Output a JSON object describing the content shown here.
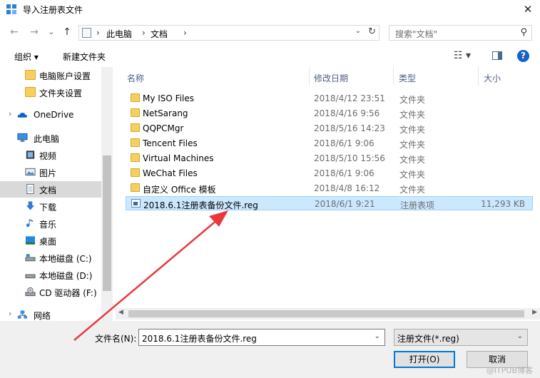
{
  "window": {
    "title": "导入注册表文件",
    "close_glyph": "✕"
  },
  "address": {
    "back_glyph": "←",
    "forward_glyph": "→",
    "recent_glyph": "⌄",
    "up_glyph": "↑",
    "separator": "›",
    "crumbs": [
      "此电脑",
      "文档"
    ],
    "search_placeholder": "搜索\"文档\"",
    "search_glyph": "⚲"
  },
  "toolbar": {
    "organize": "组织 ▾",
    "new_folder": "新建文件夹",
    "view_glyph": "☷ ▾",
    "help_glyph": "?"
  },
  "nav": {
    "items": [
      {
        "label": "电脑账户设置",
        "icon": "folder-icon"
      },
      {
        "label": "文件夹设置",
        "icon": "folder-icon"
      },
      {
        "label": "OneDrive",
        "icon": "cloud-icon"
      },
      {
        "label": "此电脑",
        "icon": "computer-icon"
      },
      {
        "label": "视频",
        "icon": "video-icon"
      },
      {
        "label": "图片",
        "icon": "picture-icon"
      },
      {
        "label": "文档",
        "icon": "document-icon"
      },
      {
        "label": "下载",
        "icon": "download-icon"
      },
      {
        "label": "音乐",
        "icon": "music-icon"
      },
      {
        "label": "桌面",
        "icon": "desktop-icon"
      },
      {
        "label": "本地磁盘 (C:)",
        "icon": "drive-icon"
      },
      {
        "label": "本地磁盘 (D:)",
        "icon": "drive-icon"
      },
      {
        "label": "CD 驱动器 (F:)",
        "icon": "cd-drive-icon"
      },
      {
        "label": "网络",
        "icon": "network-icon"
      }
    ],
    "selected": "文档"
  },
  "columns": {
    "name": "名称",
    "modified": "修改日期",
    "type": "类型",
    "size": "大小"
  },
  "files": [
    {
      "name": "My ISO Files",
      "modified": "2018/4/12 23:51",
      "type": "文件夹",
      "size": ""
    },
    {
      "name": "NetSarang",
      "modified": "2018/4/16 9:56",
      "type": "文件夹",
      "size": ""
    },
    {
      "name": "QQPCMgr",
      "modified": "2018/5/16 14:23",
      "type": "文件夹",
      "size": ""
    },
    {
      "name": "Tencent Files",
      "modified": "2018/6/1 9:06",
      "type": "文件夹",
      "size": ""
    },
    {
      "name": "Virtual Machines",
      "modified": "2018/5/10 15:56",
      "type": "文件夹",
      "size": ""
    },
    {
      "name": "WeChat Files",
      "modified": "2018/6/1 9:06",
      "type": "文件夹",
      "size": ""
    },
    {
      "name": "自定义 Office 模板",
      "modified": "2018/4/8 16:12",
      "type": "文件夹",
      "size": ""
    },
    {
      "name": "2018.6.1注册表备份文件.reg",
      "modified": "2018/6/1 9:21",
      "type": "注册表项",
      "size": "11,293 KB"
    }
  ],
  "bottom": {
    "filename_label": "文件名(N):",
    "filename_value": "2018.6.1注册表备份文件.reg",
    "filter_value": "注册文件(*.reg)",
    "open_label": "打开(O)",
    "cancel_label": "取消",
    "dropdown_glyph": "⌄"
  },
  "watermark": "@ITPUB博客",
  "colors": {
    "accent": "#0078d7",
    "selection": "#cce8ff",
    "annotation_arrow": "#e8383d"
  }
}
